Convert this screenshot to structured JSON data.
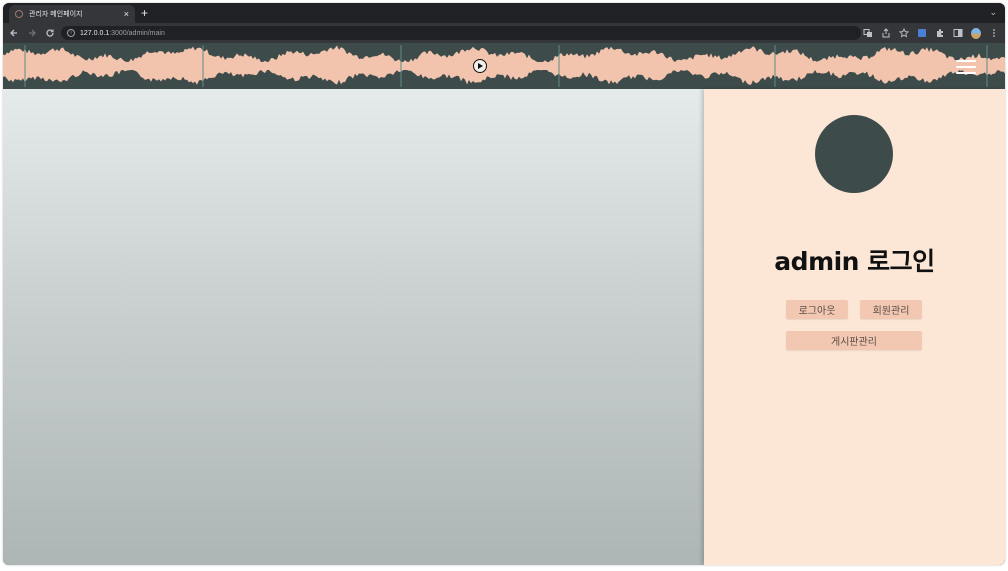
{
  "browser": {
    "tab_title": "관리자 메인페이지",
    "tab_close": "×",
    "new_tab": "+",
    "tab_search": "⌄",
    "url_host": "127.0.0.1",
    "url_path": ":3000/admin/main"
  },
  "header": {
    "wave_color": "#f2c4ad",
    "background_color": "#3e4b4b"
  },
  "sidebar": {
    "title": "admin 로그인",
    "buttons": {
      "logout": "로그아웃",
      "member_management": "회원관리",
      "board_management": "게시판관리"
    }
  },
  "icons": {
    "back": "arrow-left",
    "forward": "arrow-right",
    "reload": "reload",
    "play": "play",
    "menu": "hamburger"
  }
}
